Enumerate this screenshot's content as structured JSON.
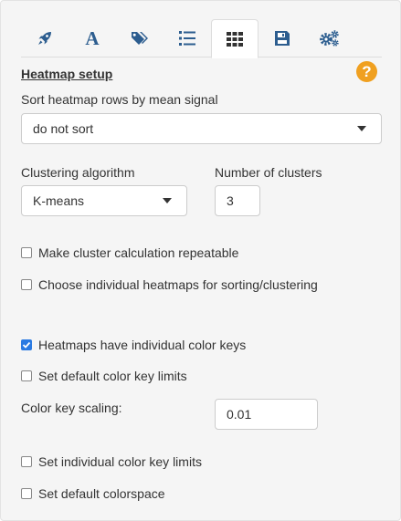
{
  "tabs": [
    {
      "icon": "rocket-icon",
      "active": false
    },
    {
      "icon": "font-icon",
      "active": false
    },
    {
      "icon": "tags-icon",
      "active": false
    },
    {
      "icon": "list-ordered-icon",
      "active": false
    },
    {
      "icon": "grid-icon",
      "active": true
    },
    {
      "icon": "save-icon",
      "active": false
    },
    {
      "icon": "gears-icon",
      "active": false
    }
  ],
  "section": {
    "title": "Heatmap setup",
    "help": "?"
  },
  "sort": {
    "label": "Sort heatmap rows by mean signal",
    "value": "do not sort"
  },
  "clustering": {
    "label": "Clustering algorithm",
    "value": "K-means"
  },
  "clusters": {
    "label": "Number of clusters",
    "value": "3"
  },
  "checks": {
    "repeatable": {
      "label": "Make cluster calculation repeatable",
      "checked": false
    },
    "individual_heatmaps": {
      "label": "Choose individual heatmaps for sorting/clustering",
      "checked": false
    },
    "individual_keys": {
      "label": "Heatmaps have individual color keys",
      "checked": true
    },
    "default_limits": {
      "label": "Set default color key limits",
      "checked": false
    },
    "individual_limits": {
      "label": "Set individual color key limits",
      "checked": false
    },
    "default_colorspace": {
      "label": "Set default colorspace",
      "checked": false
    }
  },
  "scaling": {
    "label": "Color key scaling:",
    "value": "0.01"
  },
  "colors": {
    "link": "#2c5d8f",
    "help": "#f0a020",
    "check": "#2a7ae2"
  }
}
